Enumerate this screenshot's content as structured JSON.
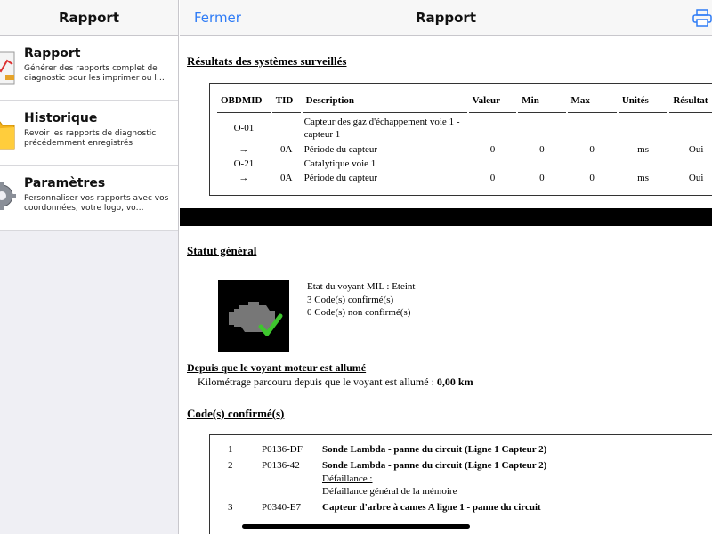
{
  "sidebar": {
    "title": "Rapport",
    "items": [
      {
        "title": "Rapport",
        "subtitle": "Générer des rapports complet de diagnostic pour les imprimer ou l…"
      },
      {
        "title": "Historique",
        "subtitle": "Revoir les rapports de diagnostic précédemment enregistrés"
      },
      {
        "title": "Paramètres",
        "subtitle": "Personnaliser vos rapports avec vos coordonnées, votre logo, vo…"
      }
    ]
  },
  "nav": {
    "close_label": "Fermer",
    "title": "Rapport",
    "print_icon": "printer-icon"
  },
  "monitors": {
    "title": "Résultats des systèmes surveillés",
    "headers": [
      "OBDMID",
      "TID",
      "Description",
      "Valeur",
      "Min",
      "Max",
      "Unités",
      "Résultat"
    ],
    "rows": [
      [
        "O-01",
        "",
        "Capteur des gaz d'échappement voie 1 - capteur 1",
        "",
        "",
        "",
        "",
        ""
      ],
      [
        "→",
        "0A",
        "Période du capteur",
        "0",
        "0",
        "0",
        "ms",
        "Oui"
      ],
      [
        "O-21",
        "",
        "Catalytique voie 1",
        "",
        "",
        "",
        "",
        ""
      ],
      [
        "→",
        "0A",
        "Période du capteur",
        "0",
        "0",
        "0",
        "ms",
        "Oui"
      ]
    ]
  },
  "status": {
    "title": "Statut général",
    "mil": "Etat du voyant MIL : Eteint",
    "confirmed": "3 Code(s) confirmé(s)",
    "unconfirmed": "0 Code(s) non confirmé(s)"
  },
  "since": {
    "title": "Depuis que le voyant moteur est allumé",
    "text": "Kilométrage parcouru depuis que le voyant est allumé : ",
    "value": "0,00 km"
  },
  "codes": {
    "title": "Code(s) confirmé(s)",
    "items": [
      {
        "num": "1",
        "code": "P0136-DF",
        "desc": "Sonde Lambda - panne du circuit (Ligne 1 Capteur 2)"
      },
      {
        "num": "2",
        "code": "P0136-42",
        "desc": "Sonde Lambda - panne du circuit (Ligne 1 Capteur 2)",
        "fault_label": "Défaillance :",
        "fault_text": "Défaillance général de la mémoire"
      },
      {
        "num": "3",
        "code": "P0340-E7",
        "desc": "Capteur d'arbre à cames A ligne 1 - panne du circuit"
      }
    ]
  },
  "colors": {
    "accent": "#2f7cf6",
    "check": "#3ec62e"
  }
}
